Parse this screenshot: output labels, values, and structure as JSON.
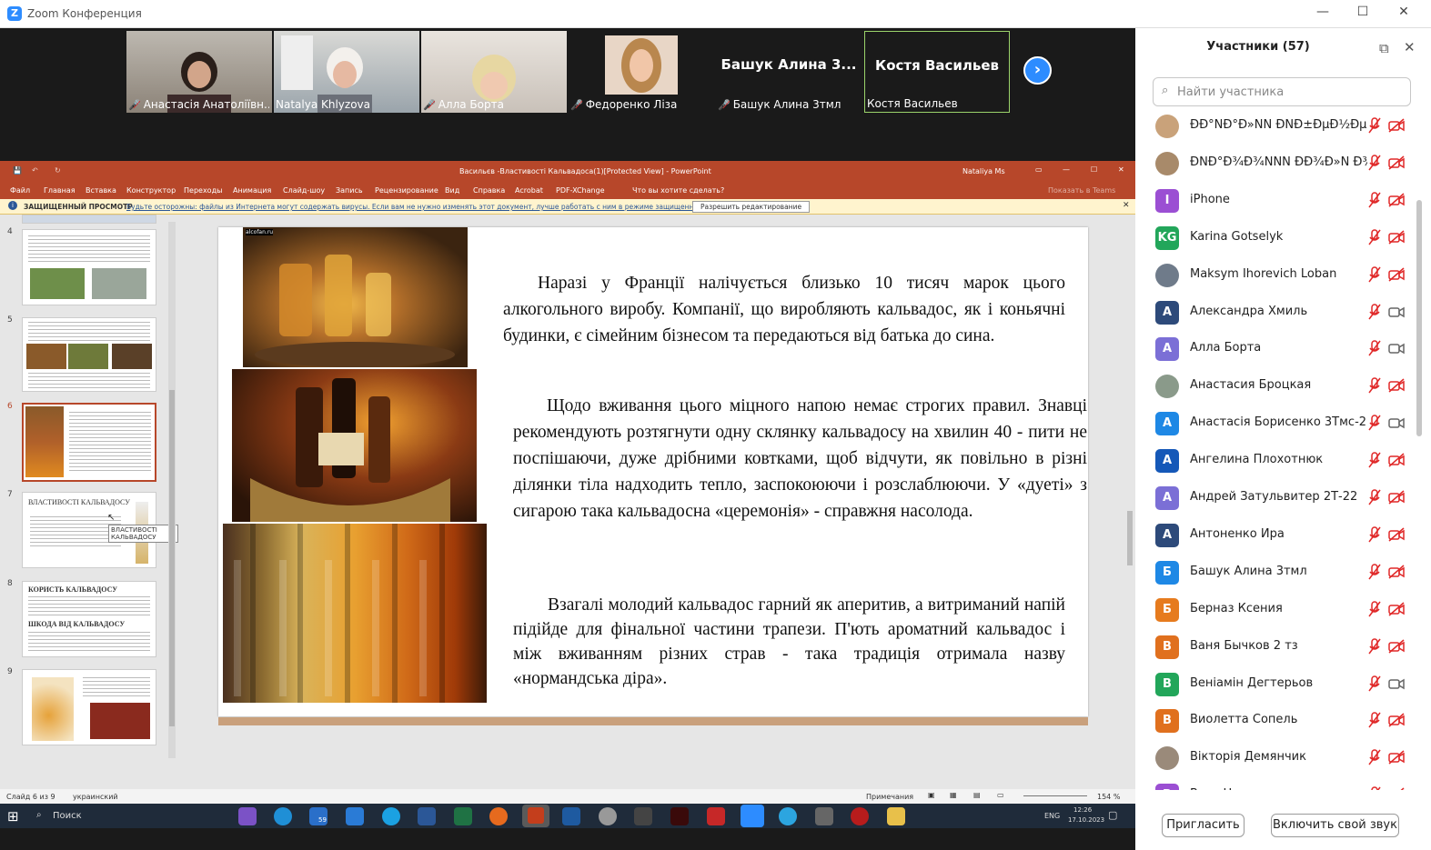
{
  "window": {
    "title": "Zoom Конференция"
  },
  "videos": [
    {
      "name": "Анастасія Анатоліївн..."
    },
    {
      "name": "Natalya Khlyzova"
    },
    {
      "name": "Алла Борта"
    },
    {
      "name": "Федоренко Ліза"
    },
    {
      "name": "Башук Алина 3тмл",
      "big": "Башук Алина 3..."
    },
    {
      "name": "Костя Васильев",
      "big": "Костя Васильев"
    }
  ],
  "ppt": {
    "title": "Васильєв -Властивості Кальвадоса(1)[Protected View] - PowerPoint",
    "user": "Nataliya Ms",
    "tabs": [
      "Файл",
      "Главная",
      "Вставка",
      "Конструктор",
      "Переходы",
      "Анимация",
      "Слайд-шоу",
      "Запись",
      "Рецензирование",
      "Вид",
      "Справка",
      "Acrobat",
      "PDF-XChange"
    ],
    "tell": "Что вы хотите сделать?",
    "share": "Показать в Teams",
    "protected_label": "ЗАЩИЩЕННЫЙ ПРОСМОТР",
    "protected_text": "Будьте осторожны: файлы из Интернета могут содержать вирусы. Если вам не нужно изменять этот документ, лучше работать с ним в режиме защищенного просмотра.",
    "enable_btn": "Разрешить редактирование",
    "thumbs": [
      {
        "num": "4"
      },
      {
        "num": "5"
      },
      {
        "num": "6"
      },
      {
        "num": "7",
        "title": "ВЛАСТИВОСТІ КАЛЬВАДОСУ",
        "tooltip": "ВЛАСТИВОСТІ КАЛЬВАДОСУ"
      },
      {
        "num": "8",
        "title": "КОРИСТЬ КАЛЬВАДОСУ",
        "title2": "ШКОДА ВІД КАЛЬВАДОСУ"
      },
      {
        "num": "9"
      }
    ],
    "slide": {
      "photo_watermark": "alcofan.ru",
      "p1": "Наразі у Франції налічується близько 10 тисяч марок цього алкогольного виробу. Компанії, що виробляють кальвадос, як і коньячні будинки, є сімейним бізнесом та передаються від батька до сина.",
      "p2": "Щодо вживання цього міцного напою немає строгих правил. Знавці рекомендують розтягнути одну склянку кальвадосу на хвилин 40 - пити не поспішаючи, дуже дрібними ковтками, щоб відчути, як повільно в різні ділянки тіла надходить тепло, заспокоюючи і розслаблюючи. У «дуеті» з сигарою така кальвадосна «церемонія» - справжня насолода.",
      "p3": "Взагалі молодий кальвадос гарний як аперитив, а витриманий напій підійде для фінальної частини трапези. П'ють ароматний кальвадос і між вживанням різних страв - така традиція отримала назву «нормандська діра»."
    },
    "status": {
      "slide": "Слайд 6 из 9",
      "lang": "украинский",
      "notes": "Примечания",
      "zoom": "154 %"
    }
  },
  "taskbar": {
    "search": "Поиск",
    "lang": "ENG",
    "time": "12:26",
    "date": "17.10.2023",
    "mail_badge": "59"
  },
  "participants": {
    "title": "Участники (57)",
    "search_placeholder": "Найти участника",
    "list": [
      {
        "name": "ÐÐ°ÑÐ°Ð»ÑÑ ÐÑÐ±ÐµÐ½ÐµÑ",
        "initial": "",
        "color": "#c9a27a",
        "cam": "off"
      },
      {
        "name": "ÐÑÐ°Ð¾Ð¾ÑÑÑ ÐÐ¾Ð»Ñ Ð¾Ð...",
        "initial": "",
        "color": "#a88a6a",
        "cam": "off"
      },
      {
        "name": "iPhone",
        "initial": "I",
        "color": "#9b4fd3",
        "cam": "off"
      },
      {
        "name": "Karina Gotselyk",
        "initial": "KG",
        "color": "#22a65a",
        "cam": "off"
      },
      {
        "name": "Maksym Ihorevich Loban",
        "initial": "",
        "color": "#6f7b8a",
        "cam": "off"
      },
      {
        "name": "Александра Хмиль",
        "initial": "А",
        "color": "#2d4a7a",
        "cam": "on"
      },
      {
        "name": "Алла Борта",
        "initial": "А",
        "color": "#7b6fd6",
        "cam": "on"
      },
      {
        "name": "Анастасия Броцкая",
        "initial": "",
        "color": "#8a9a8a",
        "cam": "off"
      },
      {
        "name": "Анастасія Борисенко 3Тмс-21",
        "initial": "А",
        "color": "#1e88e5",
        "cam": "on"
      },
      {
        "name": "Ангелина  Плохотнюк",
        "initial": "А",
        "color": "#1558b8",
        "cam": "off"
      },
      {
        "name": "Андрей Затульвитер 2Т-22",
        "initial": "А",
        "color": "#7b6fd6",
        "cam": "off"
      },
      {
        "name": "Антоненко Ира",
        "initial": "А",
        "color": "#2d4a7a",
        "cam": "off"
      },
      {
        "name": "Башук Алина 3тмл",
        "initial": "Б",
        "color": "#1e88e5",
        "cam": "off"
      },
      {
        "name": "Берназ Ксения",
        "initial": "Б",
        "color": "#e67b1e",
        "cam": "off"
      },
      {
        "name": "Ваня Бычков 2 тз",
        "initial": "В",
        "color": "#e0701e",
        "cam": "off"
      },
      {
        "name": "Веніамін Дегтерьов",
        "initial": "В",
        "color": "#22a65a",
        "cam": "on"
      },
      {
        "name": "Виолетта  Сопель",
        "initial": "В",
        "color": "#e0701e",
        "cam": "off"
      },
      {
        "name": "Вікторія Демянчик",
        "initial": "",
        "color": "#9a8a7a",
        "cam": "off"
      },
      {
        "name": "Вовк Настя",
        "initial": "В",
        "color": "#9b4fd3",
        "cam": "off"
      }
    ],
    "invite_btn": "Пригласить",
    "unmute_btn": "Включить свой звук"
  }
}
